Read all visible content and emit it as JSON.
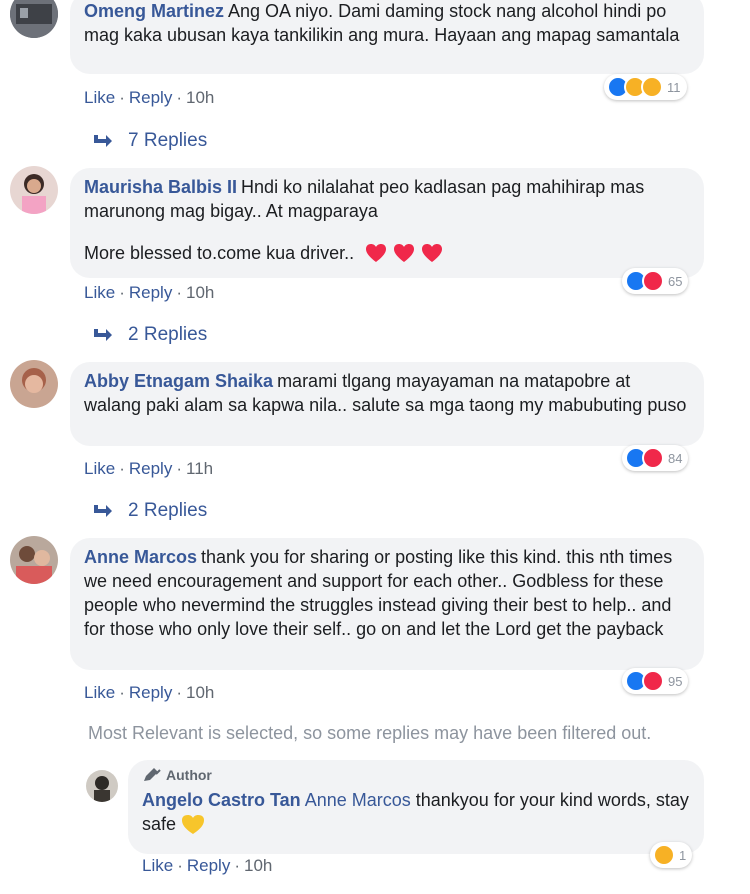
{
  "comments": [
    {
      "author": "Omeng Martinez",
      "text": "Ang OA niyo. Dami daming stock nang alcohol hindi po mag kaka ubusan kaya tankilikin ang mura. Hayaan ang mapag samantala",
      "like": "Like",
      "reply": "Reply",
      "time": "10h",
      "reaction_count": "11",
      "replies_label": "7 Replies"
    },
    {
      "author": "Maurisha Balbis II",
      "text": "Hndi ko nilalahat peo kadlasan pag mahihirap mas marunong mag bigay.. At magparaya",
      "text2": "More blessed to.come kua driver..",
      "like": "Like",
      "reply": "Reply",
      "time": "10h",
      "reaction_count": "65",
      "replies_label": "2 Replies"
    },
    {
      "author": "Abby Etnagam Shaika",
      "text": "marami tlgang mayayaman na matapobre at walang paki alam sa kapwa nila.. salute sa mga taong my mabubuting puso",
      "like": "Like",
      "reply": "Reply",
      "time": "11h",
      "reaction_count": "84",
      "replies_label": "2 Replies"
    },
    {
      "author": "Anne Marcos",
      "text": "thank you for sharing or posting like this kind. this nth times we need encouragement and support for each other.. Godbless for these people who nevermind the struggles instead giving their best to help.. and for those who only love their self.. go on and let the Lord get the payback",
      "like": "Like",
      "reply": "Reply",
      "time": "10h",
      "reaction_count": "95"
    }
  ],
  "filter_notice": "Most Relevant is selected, so some replies may have been filtered out.",
  "reply": {
    "badge": "Author",
    "author": "Angelo Castro Tan",
    "mention": "Anne Marcos",
    "text": "thankyou for your kind words, stay safe",
    "like": "Like",
    "reply": "Reply",
    "time": "10h",
    "reaction_count": "1"
  },
  "colors": {
    "link": "#385898",
    "bubble": "#f2f3f5",
    "like_blue": "#1877f2",
    "love_red": "#f0284a",
    "haha_yellow": "#f7b125"
  }
}
